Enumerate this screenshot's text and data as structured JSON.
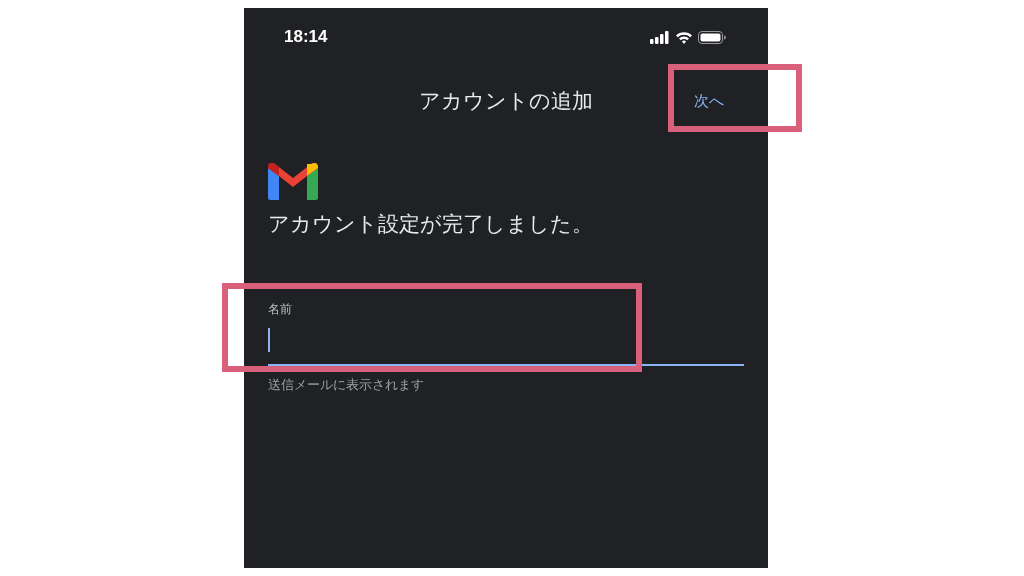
{
  "status_bar": {
    "time": "18:14"
  },
  "header": {
    "title": "アカウントの追加",
    "next_button": "次へ"
  },
  "message": "アカウント設定が完了しました。",
  "name_field": {
    "label": "名前",
    "focused": true,
    "helper": "送信メールに表示されます"
  },
  "annotations": [
    {
      "kind": "box",
      "highlighted": true
    },
    {
      "kind": "box",
      "highlighted": true
    }
  ]
}
